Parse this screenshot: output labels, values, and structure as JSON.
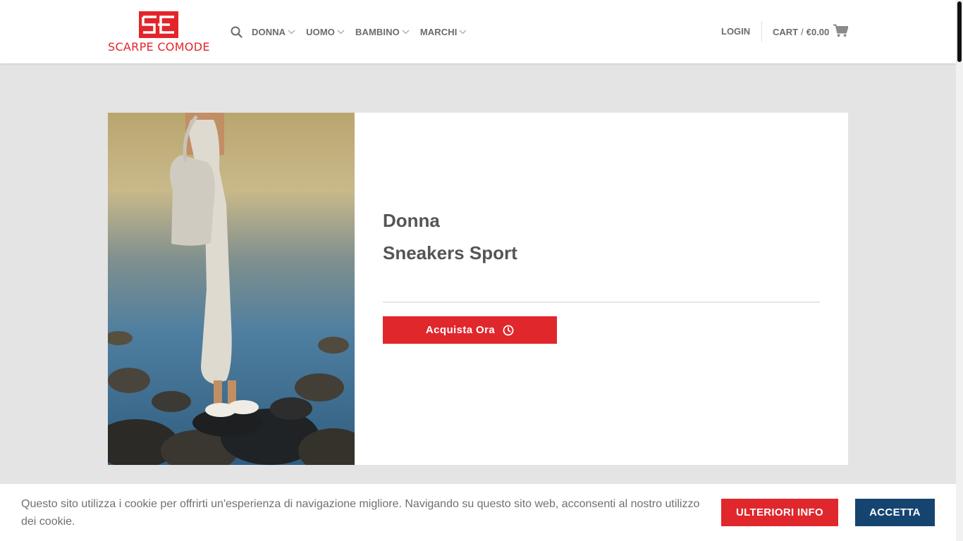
{
  "brand": {
    "name": "SCARPE COMODE",
    "color": "#e3252b"
  },
  "nav": {
    "search_icon": "search-icon",
    "items": [
      {
        "label": "DONNA"
      },
      {
        "label": "UOMO"
      },
      {
        "label": "BAMBINO"
      },
      {
        "label": "MARCHI"
      }
    ]
  },
  "account": {
    "login_label": "LOGIN"
  },
  "cart": {
    "label": "CART",
    "separator": "/",
    "total": "€0.00",
    "icon": "cart-icon"
  },
  "banner": {
    "image_alt": "Donna con borsa bianca e sneakers bianche sugli scogli",
    "title": "Donna",
    "subtitle": "Sneakers Sport",
    "button_label": "Acquista Ora",
    "button_icon": "clock-icon",
    "accent": "#e0272c"
  },
  "cookie": {
    "message": "Questo sito utilizza i cookie per offrirti un'esperienza di navigazione migliore. Navigando su questo sito web, acconsenti al nostro utilizzo dei cookie.",
    "info_label": "ULTERIORI INFO",
    "accept_label": "ACCETTA",
    "accept_color": "#164470"
  }
}
